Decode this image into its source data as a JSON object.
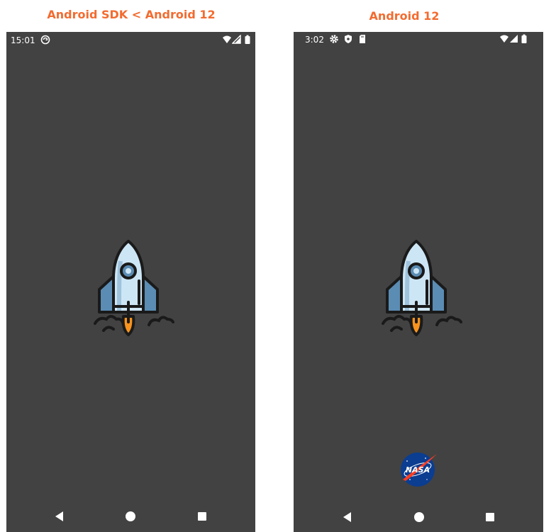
{
  "headings": {
    "left": "Android SDK < Android 12",
    "right": "Android 12"
  },
  "phones": [
    {
      "status_time": "15:01",
      "status_icons": [
        "sync-icon",
        "wifi-icon",
        "signal-icon",
        "battery-icon"
      ],
      "splash_icon": "rocket-icon",
      "nav_buttons": [
        "back-icon",
        "home-icon",
        "recents-icon"
      ]
    },
    {
      "status_time": "3:02",
      "status_icons": [
        "settings-icon",
        "shield-icon",
        "sd-card-icon",
        "wifi-icon",
        "signal-icon",
        "battery-icon"
      ],
      "splash_icon": "rocket-icon",
      "branding": {
        "icon": "nasa-logo",
        "text": "NASA"
      },
      "nav_buttons": [
        "back-icon",
        "home-icon",
        "recents-icon"
      ]
    }
  ],
  "colors": {
    "heading": "#f36b2f",
    "screen_bg": "#424242",
    "rocket_body": "#cde6f5",
    "rocket_wings": "#5b8cb3",
    "flame": "#f7931e",
    "nasa_blue": "#0b3d91",
    "nasa_red": "#fc3d21"
  }
}
